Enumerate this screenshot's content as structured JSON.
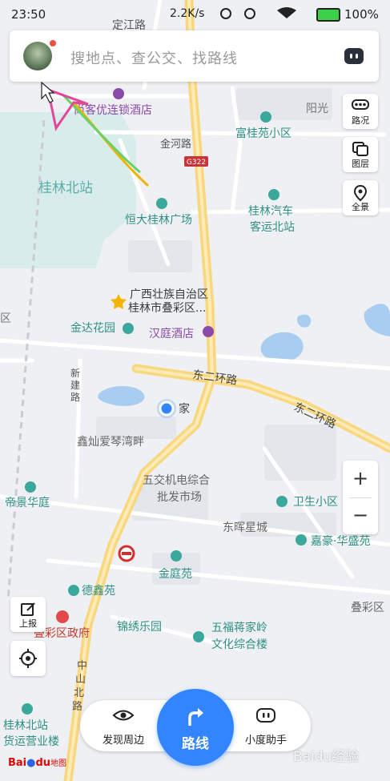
{
  "status_bar": {
    "time": "23:50",
    "net_speed": "2.2K/s",
    "battery_pct": "100%",
    "icons": [
      "signal-icon",
      "alarm-icon",
      "wifi-icon",
      "battery-icon"
    ]
  },
  "search": {
    "placeholder": "搜地点、查公交、找路线",
    "assistant_icon": "robot-face-icon"
  },
  "side_buttons": {
    "traffic": "路况",
    "layers": "图层",
    "panorama": "全景"
  },
  "zoom": {
    "in": "+",
    "out": "−"
  },
  "left_buttons": {
    "report": "上报"
  },
  "bottom": {
    "discover": "发现周边",
    "route": "路线",
    "assistant": "小度助手"
  },
  "map_labels": {
    "dingjiang_road": "定江路",
    "shangke_hotel": "尚客优连锁酒店",
    "yangguang": "阳光",
    "fuguiyuan": "富桂苑小区",
    "jinhe_road": "金河路",
    "g322": "G322",
    "guilin_north": "桂林北站",
    "hengda": "恒大桂林广场",
    "bus_station_1": "桂林汽车",
    "bus_station_2": "客运北站",
    "guangxi_1": "广西壮族自治区",
    "guangxi_2": "桂林市叠彩区...",
    "jinda": "金达花园",
    "hanting": "汉庭酒店",
    "ring_road_1": "东二环路",
    "ring_road_2": "东二环路",
    "xinjian_1": "新",
    "xinjian_2": "建",
    "xinjian_3": "路",
    "home": "家",
    "xinhao": "鑫灿爱琴湾畔",
    "wujiao_1": "五交机电综合",
    "wujiao_2": "批发市场",
    "weisheng": "卫生小区",
    "dihui": "帝景华庭",
    "donghui": "东晖星城",
    "jiahao": "嘉豪·华盛苑",
    "jinting": "金庭苑",
    "dexin": "德鑫苑",
    "diecai_district": "叠彩区",
    "gov": "叠彩区政府",
    "jinxiu": "锦绣乐园",
    "wufu_1": "五福蒋家岭",
    "wufu_2": "文化综合楼",
    "zhongshan_1": "中",
    "zhongshan_2": "山",
    "zhongshan_3": "北",
    "zhongshan_4": "路",
    "guilin_north_2": "桂林北站",
    "freight": "货运营业楼",
    "qu": "区"
  },
  "logo": {
    "bai": "Bai",
    "du": "du",
    "map": "地图"
  },
  "watermark": "Baidu经验",
  "colors": {
    "accent": "#3385ff",
    "main_road": "#f9d77e",
    "poi": "#3aa89b",
    "hotel": "#8a4aa8",
    "land": "#eef0f3",
    "station_area": "#d9ecec",
    "water": "#a8cdf0"
  }
}
